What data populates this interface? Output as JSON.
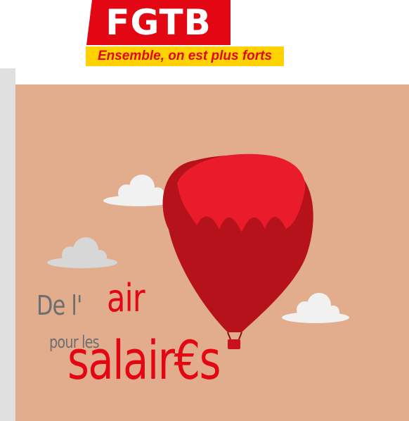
{
  "logo": {
    "text": "FGTB",
    "slogan": "Ensemble, on est plus forts"
  },
  "poster": {
    "headline_de": "De l'",
    "headline_air": "air",
    "headline_pour": "pour les",
    "headline_salaires": "salair€s"
  },
  "colors": {
    "brand_red": "#e30613",
    "slogan_yellow": "#ffd200",
    "poster_bg": "#e2ad8c",
    "text_grey": "#6c6e72",
    "balloon_dark": "#b5121b",
    "cloud": "#f1f1f1"
  }
}
